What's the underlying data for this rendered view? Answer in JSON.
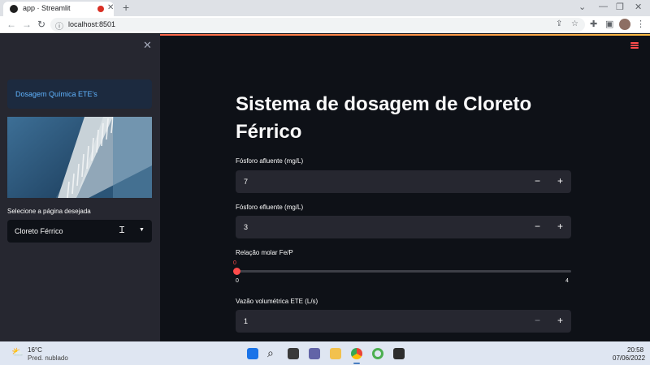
{
  "browser": {
    "tab_title": "app · Streamlit",
    "url": "localhost:8501",
    "new_tab_symbol": "+",
    "accent_record": "#d93025"
  },
  "sidebar": {
    "title": "Dosagem Química ETE's",
    "image_icon": "water-treatment-tank-image",
    "select_label": "Selecione a página desejada",
    "select_value": "Cloreto Férrico"
  },
  "main": {
    "title": "Sistema de dosagem de Cloreto Férrico",
    "fields": [
      {
        "label": "Fósforo afluente (mg/L)",
        "value": "7"
      },
      {
        "label": "Fósforo efluente (mg/L)",
        "value": "3"
      }
    ],
    "slider": {
      "label": "Relação molar Fe/P",
      "current": "0",
      "min": "0",
      "max": "4",
      "level": 0
    },
    "flow_field": {
      "label": "Vazão volumétrica ETE (L/s)",
      "value": "1"
    },
    "step_minus": "−",
    "step_plus": "+"
  },
  "taskbar": {
    "temperature": "16°C",
    "weather": "Pred. nublado",
    "time": "20:58",
    "date": "07/06/2022"
  },
  "colors": {
    "app_bg": "#0e1117",
    "sidebar_bg": "#262730",
    "accent": "#ff4b4b",
    "link": "#60b4ff"
  }
}
